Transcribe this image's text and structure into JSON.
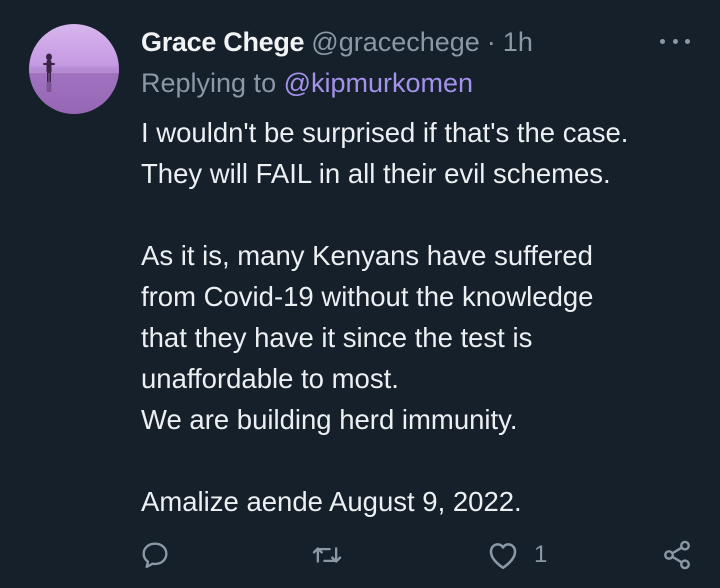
{
  "tweet": {
    "author_name": "Grace Chege",
    "author_handle": "@gracechege",
    "separator": "·",
    "time": "1h",
    "replying_prefix": "Replying to",
    "replying_to": "@kipmurkomen",
    "body_lines": [
      "I wouldn't be surprised if that's the case.",
      "They will FAIL in all their evil schemes.",
      "",
      "As it is, many Kenyans have suffered",
      "from Covid-19 without the knowledge",
      "that they have it since the test is",
      "unaffordable to most.",
      "We are building herd immunity.",
      "",
      "Amalize aende August 9, 2022."
    ],
    "like_count": "1"
  },
  "icons": {
    "avatar": "avatar-image",
    "more": "more-options-icon",
    "reply": "reply-icon",
    "retweet": "retweet-icon",
    "like": "like-icon",
    "share": "share-icon"
  },
  "colors": {
    "background": "#15202b",
    "text": "#e7e9ea",
    "muted": "#8b98a5",
    "mention": "#a491ea"
  }
}
